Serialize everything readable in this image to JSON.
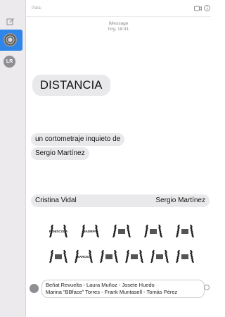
{
  "colors": {
    "accent": "#2f86e8",
    "bubble": "#e9e9eb",
    "sidebar": "#eceaec"
  },
  "sidebar": {
    "compose_icon": "compose-icon",
    "conversations": [
      {
        "avatar": "gray-disc-avatar",
        "selected": true
      },
      {
        "initials": "LR",
        "selected": false
      }
    ]
  },
  "toolbar": {
    "to_label": "Para:",
    "video_icon": "video-camera-icon",
    "info_icon": "info-icon"
  },
  "header": {
    "service": "iMessage",
    "time": "hoy, 18:41"
  },
  "messages": {
    "title": "DISTANCIA",
    "line1": "un cortometraje inquieto de",
    "line2": "Sergio Martínez",
    "credit_left": "Cristina Vidal",
    "credit_right": "Sergio Martínez"
  },
  "laurels": [
    {
      "name": "festival-laurel-peniscola",
      "text": "PENÍSCOLA"
    },
    {
      "name": "festival-laurel-madrid",
      "text": "MADRIFF"
    },
    {
      "name": "festival-laurel-3"
    },
    {
      "name": "festival-laurel-4"
    },
    {
      "name": "festival-laurel-5"
    },
    {
      "name": "festival-laurel-6"
    },
    {
      "name": "festival-laurel-barcelona",
      "text": "BARCEL"
    },
    {
      "name": "festival-laurel-8"
    },
    {
      "name": "festival-laurel-9"
    },
    {
      "name": "festival-laurel-10"
    },
    {
      "name": "festival-laurel-11"
    }
  ],
  "composer": {
    "line1": "Beñat Revuelta - Laura Muñoz - Josete Huedo",
    "line2": "Marina “BBface” Torres - Frank Muntasell - Tomás Pérez",
    "apps_icon": "app-store-icon",
    "emoji_icon": "emoji-icon"
  }
}
